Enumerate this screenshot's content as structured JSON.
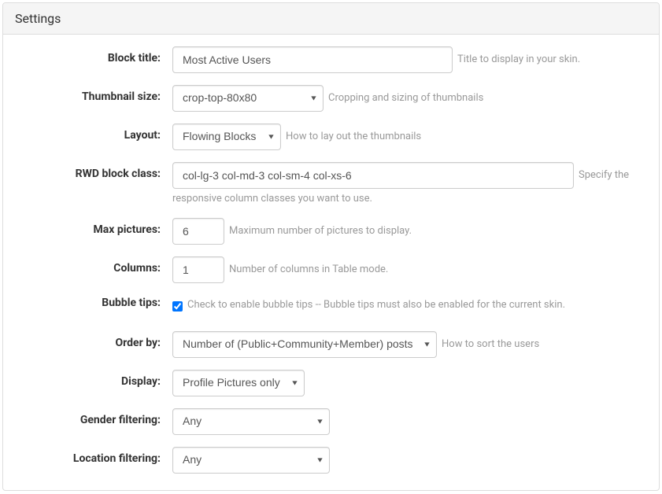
{
  "panel": {
    "title": "Settings"
  },
  "fields": {
    "block_title": {
      "label": "Block title:",
      "value": "Most Active Users",
      "help": "Title to display in your skin."
    },
    "thumbnail_size": {
      "label": "Thumbnail size:",
      "value": "crop-top-80x80",
      "help": "Cropping and sizing of thumbnails"
    },
    "layout": {
      "label": "Layout:",
      "value": "Flowing Blocks",
      "help": "How to lay out the thumbnails"
    },
    "rwd_block_class": {
      "label": "RWD block class:",
      "value": "col-lg-3 col-md-3 col-sm-4 col-xs-6",
      "help_inline": "Specify the",
      "help_wrap": "responsive column classes you want to use."
    },
    "max_pictures": {
      "label": "Max pictures:",
      "value": "6",
      "help": "Maximum number of pictures to display."
    },
    "columns": {
      "label": "Columns:",
      "value": "1",
      "help": "Number of columns in Table mode."
    },
    "bubble_tips": {
      "label": "Bubble tips:",
      "checked": true,
      "help": "Check to enable bubble tips -- Bubble tips must also be enabled for the current skin."
    },
    "order_by": {
      "label": "Order by:",
      "value": "Number of (Public+Community+Member) posts",
      "help": "How to sort the users"
    },
    "display": {
      "label": "Display:",
      "value": "Profile Pictures only"
    },
    "gender_filtering": {
      "label": "Gender filtering:",
      "value": "Any"
    },
    "location_filtering": {
      "label": "Location filtering:",
      "value": "Any"
    }
  }
}
